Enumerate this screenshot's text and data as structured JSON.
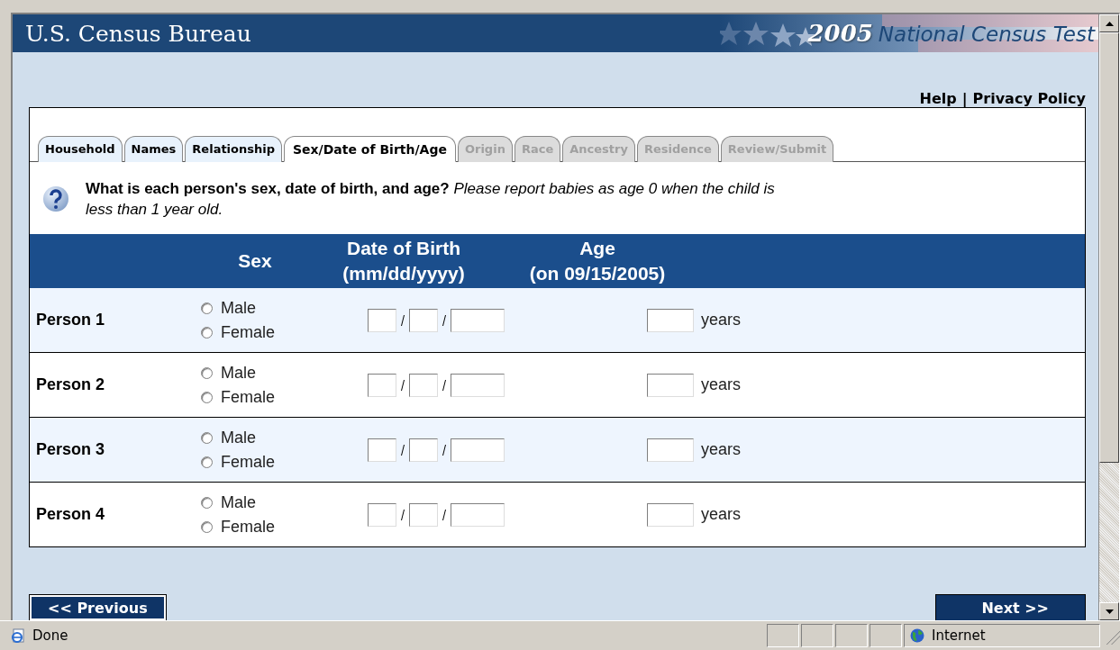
{
  "header": {
    "title": "U.S. Census Bureau",
    "year": "2005",
    "subtitle": "National Census Test"
  },
  "top_links": {
    "separator": "|",
    "items": [
      {
        "label": "Help"
      },
      {
        "label": "Privacy Policy"
      }
    ]
  },
  "tabs": [
    {
      "label": "Household",
      "selected": false,
      "disabled": false
    },
    {
      "label": "Names",
      "selected": false,
      "disabled": false
    },
    {
      "label": "Relationship",
      "selected": false,
      "disabled": false
    },
    {
      "label": "Sex/Date of Birth/Age",
      "selected": true,
      "disabled": false
    },
    {
      "label": "Origin",
      "selected": false,
      "disabled": true
    },
    {
      "label": "Race",
      "selected": false,
      "disabled": true
    },
    {
      "label": "Ancestry",
      "selected": false,
      "disabled": true
    },
    {
      "label": "Residence",
      "selected": false,
      "disabled": true
    },
    {
      "label": "Review/Submit",
      "selected": false,
      "disabled": true
    }
  ],
  "question": {
    "text": "**What is each person's sex, date of birth, and age?** *Please report babies as age 0 when the child is less than 1 year old.*"
  },
  "table": {
    "columns": [
      {
        "label": "Sex"
      },
      {
        "label": "Date of Birth",
        "sub": "(mm/dd/yyyy)"
      },
      {
        "label": "Age",
        "sub": "(on 09/15/2005)"
      }
    ],
    "rows": [
      {
        "person": "Person 1",
        "options": [
          {
            "label": "Male",
            "checked": false
          },
          {
            "label": "Female",
            "checked": false
          }
        ],
        "unit": "years"
      },
      {
        "person": "Person 2",
        "options": [
          {
            "label": "Male",
            "checked": false
          },
          {
            "label": "Female",
            "checked": false
          }
        ],
        "unit": "years"
      },
      {
        "person": "Person 3",
        "options": [
          {
            "label": "Male",
            "checked": false
          },
          {
            "label": "Female",
            "checked": false
          }
        ],
        "unit": "years"
      },
      {
        "person": "Person 4",
        "options": [
          {
            "label": "Male",
            "checked": false
          },
          {
            "label": "Female",
            "checked": false
          }
        ],
        "unit": "years"
      }
    ]
  },
  "nav": {
    "previous": "<< Previous",
    "next": "Next >>"
  },
  "status_bar": {
    "text": "Done",
    "zone": "Internet"
  }
}
